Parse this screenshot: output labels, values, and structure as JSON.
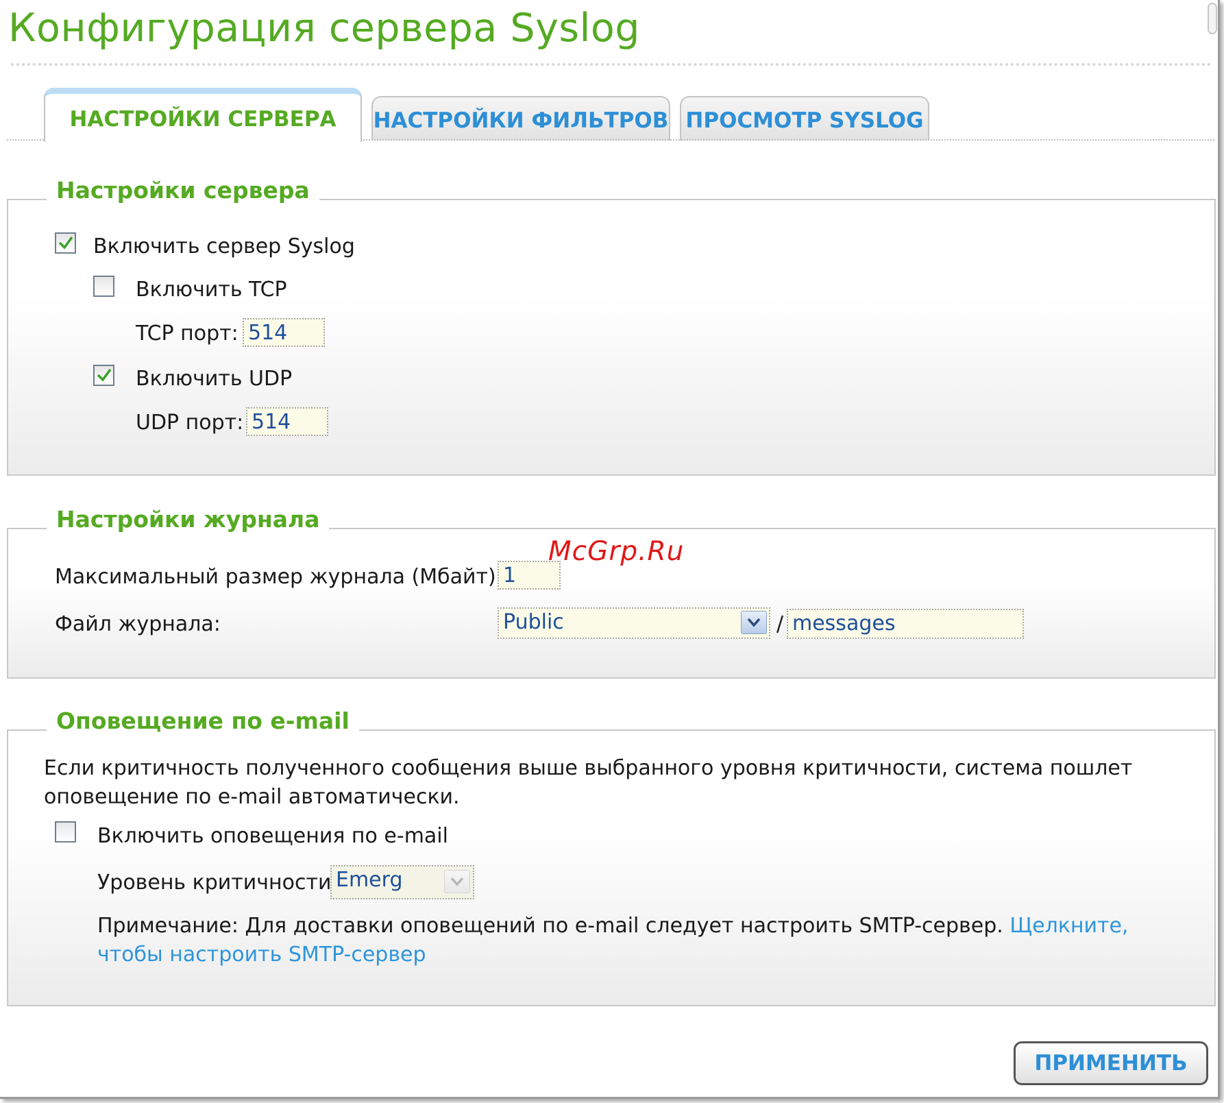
{
  "page_title": "Конфигурация сервера Syslog",
  "tabs": [
    {
      "label": "НАСТРОЙКИ СЕРВЕРА",
      "active": true
    },
    {
      "label": "НАСТРОЙКИ ФИЛЬТРОВ",
      "active": false
    },
    {
      "label": "ПРОСМОТР SYSLOG",
      "active": false
    }
  ],
  "server_settings": {
    "legend": "Настройки сервера",
    "enable_syslog": {
      "label": "Включить сервер Syslog",
      "checked": true
    },
    "enable_tcp": {
      "label": "Включить TCP",
      "checked": false
    },
    "tcp_port": {
      "label": "TCP порт:",
      "value": "514"
    },
    "enable_udp": {
      "label": "Включить UDP",
      "checked": true
    },
    "udp_port": {
      "label": "UDP порт:",
      "value": "514"
    }
  },
  "log_settings": {
    "legend": "Настройки журнала",
    "max_size": {
      "label": "Максимальный размер журнала (Мбайт):",
      "value": "1"
    },
    "log_file": {
      "label": "Файл журнала:",
      "folder": "Public",
      "separator": "/",
      "filename": "messages"
    }
  },
  "email": {
    "legend": "Оповещение по e-mail",
    "description": "Если критичность полученного сообщения выше выбранного уровня критичности, система пошлет оповещение по e-mail автоматически.",
    "enable": {
      "label": "Включить оповещения по e-mail",
      "checked": false
    },
    "severity": {
      "label": "Уровень критичности:",
      "value": "Emerg"
    },
    "note": "Примечание: Для доставки оповещений по e-mail следует настроить SMTP-сервер.",
    "note_link": "Щелкните, чтобы настроить SMTP-сервер"
  },
  "apply_label": "ПРИМЕНИТЬ",
  "watermark": "McGrp.Ru",
  "colors": {
    "accent_green": "#55aa22",
    "accent_blue": "#2d8fd6",
    "link": "#2d95dc",
    "checkmark": "#3aa02a"
  }
}
